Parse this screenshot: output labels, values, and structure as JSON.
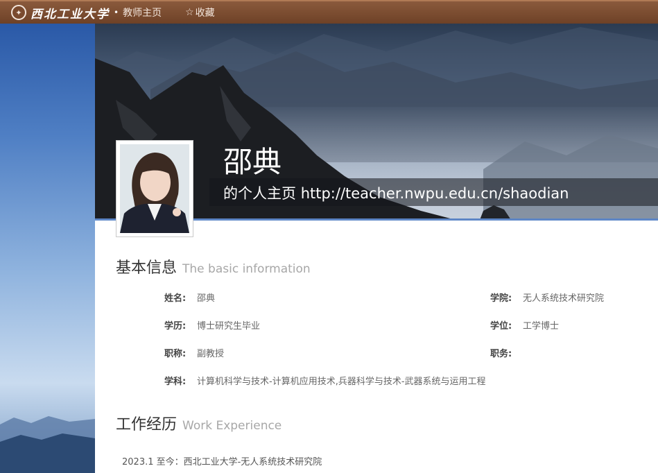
{
  "topbar": {
    "logo_text": "西北工业大学",
    "home_label": "教师主页",
    "favorite_label": "收藏"
  },
  "profile": {
    "name": "邵典",
    "homepage_label": "的个人主页",
    "homepage_url": "http://teacher.nwpu.edu.cn/shaodian"
  },
  "basic": {
    "heading_cn": "基本信息",
    "heading_en": "The basic information",
    "fields": [
      {
        "label": "姓名:",
        "value": "邵典"
      },
      {
        "label": "学院:",
        "value": "无人系统技术研究院"
      },
      {
        "label": "学历:",
        "value": "博士研究生毕业"
      },
      {
        "label": "学位:",
        "value": "工学博士"
      },
      {
        "label": "职称:",
        "value": "副教授"
      },
      {
        "label": "职务:",
        "value": ""
      },
      {
        "label": "学科:",
        "value": "计算机科学与技术-计算机应用技术,兵器科学与技术-武器系统与运用工程"
      }
    ]
  },
  "work": {
    "heading_cn": "工作经历",
    "heading_en": "Work Experience",
    "items": [
      "2023.1 至今：西北工业大学-无人系统技术研究院"
    ]
  },
  "colors": {
    "topbar": "#7a4a2e",
    "accent_blue": "#5d86c6"
  }
}
